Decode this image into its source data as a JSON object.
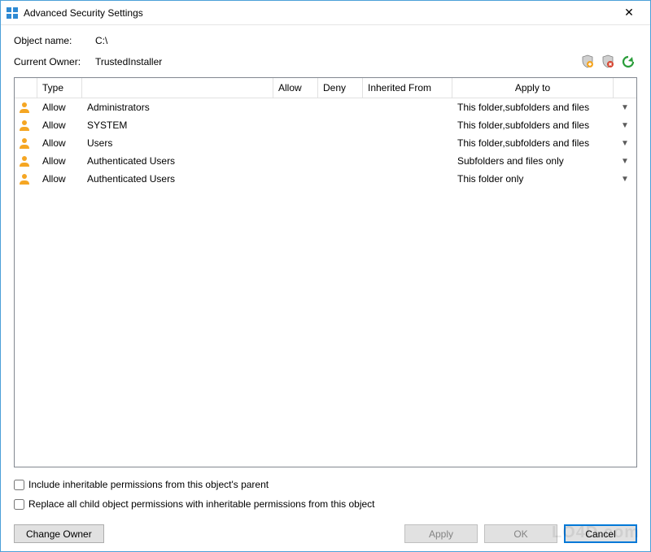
{
  "titlebar": {
    "title": "Advanced Security Settings"
  },
  "fields": {
    "object_name_label": "Object name:",
    "object_name_value": "C:\\",
    "current_owner_label": "Current Owner:",
    "current_owner_value": "TrustedInstaller"
  },
  "table": {
    "headers": {
      "icon": "",
      "type": "Type",
      "name": "",
      "allow": "Allow",
      "deny": "Deny",
      "inherited_from": "Inherited From",
      "apply_to": "Apply to"
    },
    "rows": [
      {
        "type": "Allow",
        "name": "Administrators",
        "allow": "",
        "deny": "",
        "inherited_from": "",
        "apply_to": "This folder,subfolders and files"
      },
      {
        "type": "Allow",
        "name": "SYSTEM",
        "allow": "",
        "deny": "",
        "inherited_from": "",
        "apply_to": "This folder,subfolders and files"
      },
      {
        "type": "Allow",
        "name": "Users",
        "allow": "",
        "deny": "",
        "inherited_from": "",
        "apply_to": "This folder,subfolders and files"
      },
      {
        "type": "Allow",
        "name": "Authenticated Users",
        "allow": "",
        "deny": "",
        "inherited_from": "",
        "apply_to": "Subfolders and files only"
      },
      {
        "type": "Allow",
        "name": "Authenticated Users",
        "allow": "",
        "deny": "",
        "inherited_from": "",
        "apply_to": "This folder only"
      }
    ]
  },
  "checkboxes": {
    "include_inheritable": "Include inheritable permissions from this object's parent",
    "replace_all_child": "Replace all child object permissions with inheritable permissions from this object"
  },
  "buttons": {
    "change_owner": "Change Owner",
    "apply": "Apply",
    "ok": "OK",
    "cancel": "Cancel"
  },
  "watermark": "LO4D.com"
}
